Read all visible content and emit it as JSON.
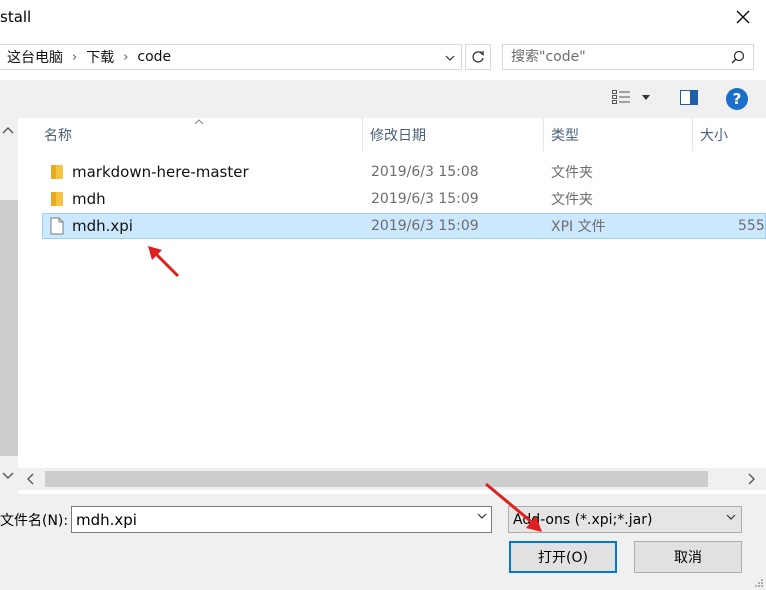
{
  "window": {
    "title": "stall",
    "close_glyph": "✕"
  },
  "address": {
    "breadcrumbs": [
      "这台电脑",
      "下载",
      "code"
    ],
    "separator": "›",
    "search_placeholder": "搜索\"code\""
  },
  "columns": {
    "name": "名称",
    "date": "修改日期",
    "type": "类型",
    "size": "大小"
  },
  "files": [
    {
      "name": "markdown-here-master",
      "date": "2019/6/3 15:08",
      "type": "文件夹",
      "size": "",
      "icon": "folder-icon"
    },
    {
      "name": "mdh",
      "date": "2019/6/3 15:09",
      "type": "文件夹",
      "size": "",
      "icon": "folder-icon"
    },
    {
      "name": "mdh.xpi",
      "date": "2019/6/3 15:09",
      "type": "XPI 文件",
      "size": "555",
      "icon": "file-icon",
      "selected": true
    }
  ],
  "filename": {
    "label": "文件名(N):",
    "value": "mdh.xpi"
  },
  "filter": {
    "value": "Add-ons (*.xpi;*.jar)"
  },
  "buttons": {
    "open": "打开(O)",
    "cancel": "取消"
  },
  "toolbar": {
    "help_glyph": "?"
  },
  "colors": {
    "selection": "#cce8ff",
    "accent": "#0078d7",
    "annotation_arrow": "#e02020",
    "folder": "#f5c242"
  }
}
